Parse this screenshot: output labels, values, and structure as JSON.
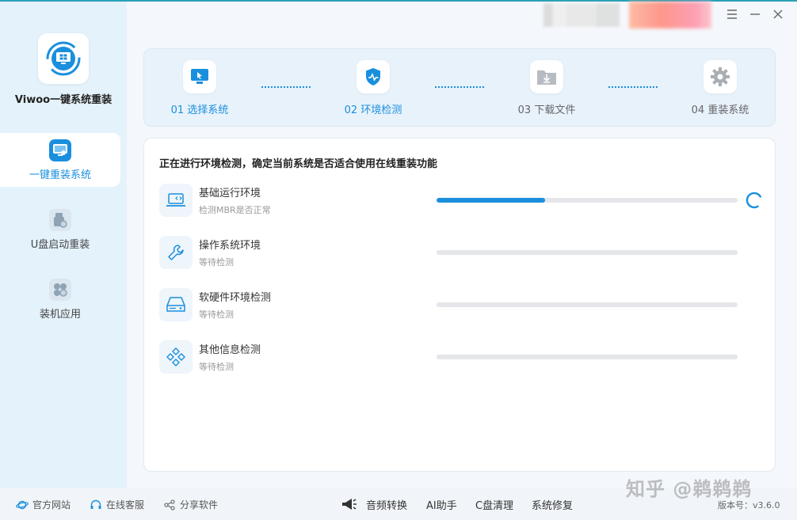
{
  "app": {
    "name": "Viwoo一键系统重装"
  },
  "sidebar": {
    "items": [
      {
        "label": "一键重装系统",
        "active": true
      },
      {
        "label": "U盘启动重装",
        "active": false
      },
      {
        "label": "装机应用",
        "active": false
      }
    ]
  },
  "steps": [
    {
      "label": "01 选择系统",
      "icon": "monitor-cursor-icon",
      "done": true
    },
    {
      "label": "02 环境检测",
      "icon": "shield-pulse-icon",
      "done": true
    },
    {
      "label": "03 下载文件",
      "icon": "download-folder-icon",
      "done": false
    },
    {
      "label": "04 重装系统",
      "icon": "gear-icon",
      "done": false
    }
  ],
  "main": {
    "title": "正在进行环境检测，确定当前系统是否适合使用在线重装功能",
    "checks": [
      {
        "title": "基础运行环境",
        "status": "检测MBR是否正常",
        "progress": 0.36,
        "icon": "laptop-code-icon"
      },
      {
        "title": "操作系统环境",
        "status": "等待检测",
        "progress": 0,
        "icon": "wrench-icon"
      },
      {
        "title": "软硬件环境检测",
        "status": "等待检测",
        "progress": 0,
        "icon": "hard-drive-icon"
      },
      {
        "title": "其他信息检测",
        "status": "等待检测",
        "progress": 0,
        "icon": "diamond-grid-icon"
      }
    ]
  },
  "footer": {
    "links": [
      "官方网站",
      "在线客服",
      "分享软件"
    ],
    "tools": [
      "音频转换",
      "AI助手",
      "C盘清理",
      "系统修复"
    ],
    "version": "版本号：v3.6.0",
    "watermark": "知乎 @鹈鹈鹈"
  },
  "colors": {
    "accent": "#1a8fdd",
    "sidebar_bg": "#e4f2fb"
  }
}
